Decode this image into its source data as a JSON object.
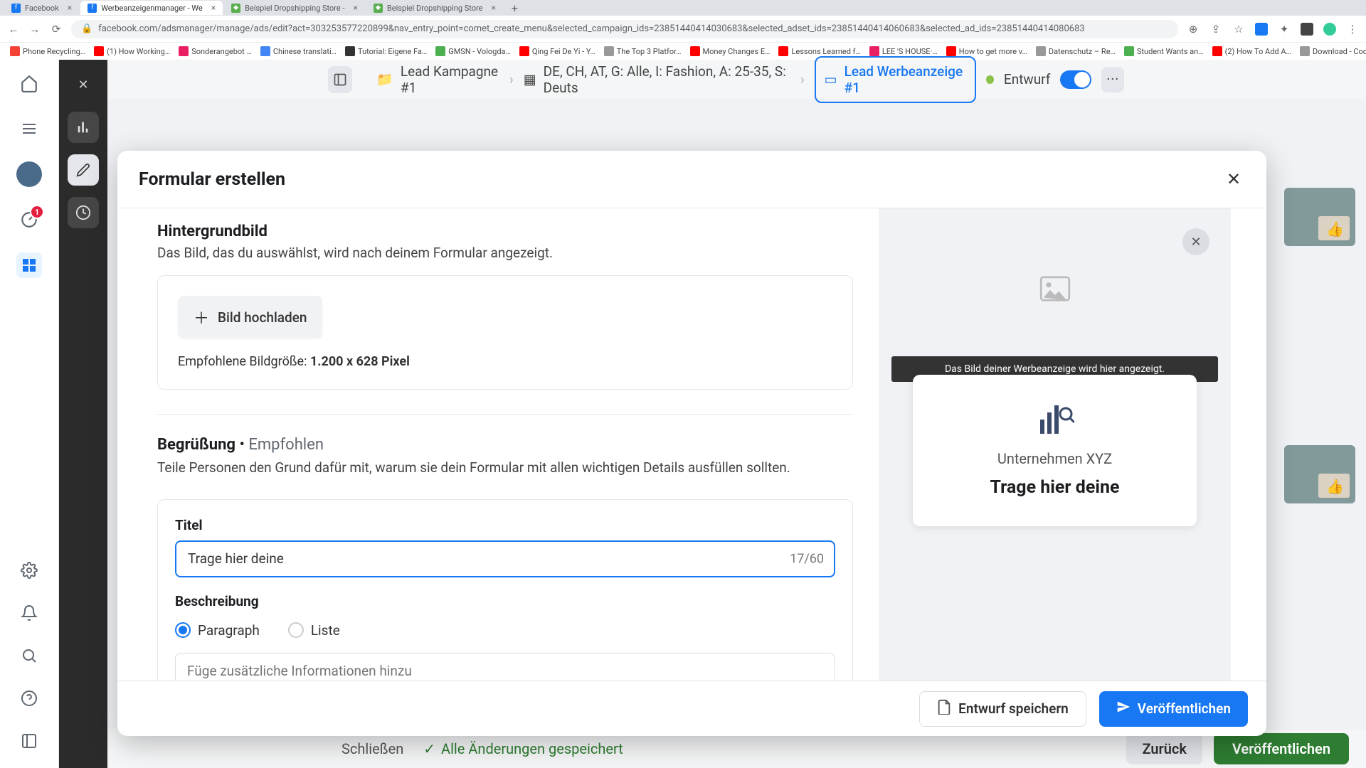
{
  "browser": {
    "tabs": [
      {
        "title": "Facebook",
        "favicon_bg": "#1877f2",
        "favicon_char": "f"
      },
      {
        "title": "Werbeanzeigenmanager - We",
        "favicon_bg": "#1877f2",
        "favicon_char": "f"
      },
      {
        "title": "Beispiel Dropshipping Store -",
        "favicon_bg": "#5bae4f",
        "favicon_char": "◆"
      },
      {
        "title": "Beispiel Dropshipping Store",
        "favicon_bg": "#5bae4f",
        "favicon_char": "◆"
      }
    ],
    "url": "facebook.com/adsmanager/manage/ads/edit?act=303253577220899&nav_entry_point=comet_create_menu&selected_campaign_ids=23851440414030683&selected_adset_ids=23851440414060683&selected_ad_ids=23851440414080683",
    "bookmarks": [
      "Phone Recycling…",
      "(1) How Working…",
      "Sonderangebot …",
      "Chinese translati…",
      "Tutorial: Eigene Fa…",
      "GMSN - Vologda…",
      "Qing Fei De Yi - Y…",
      "The Top 3 Platfor…",
      "Money Changes E…",
      "Lessons Learned f…",
      "LEE 'S HOUSE·…",
      "How to get more v…",
      "Datenschutz – Re…",
      "Student Wants an…",
      "(2) How To Add A…",
      "Download - Cooki…"
    ]
  },
  "sidebar": {
    "badge": "1"
  },
  "breadcrumbs": {
    "campaign": "Lead Kampagne #1",
    "adset": "DE, CH, AT, G: Alle, I: Fashion, A: 25-35, S: Deuts",
    "ad": "Lead Werbeanzeige #1",
    "status": "Entwurf"
  },
  "editor_footer": {
    "close": "Schließen",
    "saved": "Alle Änderungen gespeichert",
    "back": "Zurück",
    "publish": "Veröffentlichen"
  },
  "modal": {
    "title": "Formular erstellen",
    "bg_image": {
      "title": "Hintergrundbild",
      "desc": "Das Bild, das du auswählst, wird nach deinem Formular angezeigt.",
      "upload_label": "Bild hochladen",
      "rec_label": "Empfohlene Bildgröße: ",
      "rec_value": "1.200 x 628 Pixel"
    },
    "greeting": {
      "title": "Begrüßung",
      "rec": "Empfohlen",
      "sep": " • ",
      "desc": "Teile Personen den Grund dafür mit, warum sie dein Formular mit allen wichtigen Details ausfüllen sollten.",
      "title_label": "Titel",
      "title_value": "Trage hier deine ",
      "title_count": "17/60",
      "desc_label": "Beschreibung",
      "radio_paragraph": "Paragraph",
      "radio_list": "Liste",
      "extra_placeholder": "Füge zusätzliche Informationen hinzu"
    },
    "preview": {
      "banner": "Das Bild deiner Werbeanzeige wird hier angezeigt.",
      "company": "Unternehmen XYZ",
      "headline": "Trage hier deine"
    },
    "footer": {
      "save_draft": "Entwurf speichern",
      "publish": "Veröffentlichen"
    }
  }
}
